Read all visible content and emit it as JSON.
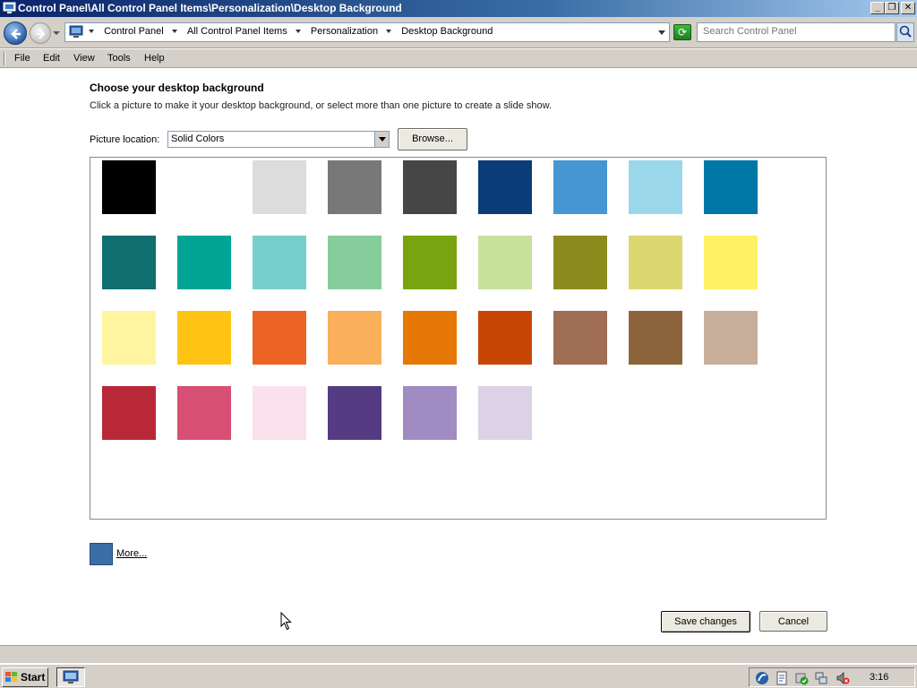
{
  "window": {
    "title": "Control Panel\\All Control Panel Items\\Personalization\\Desktop Background",
    "controls": {
      "minimize": "_",
      "restore": "❐",
      "close": "✕"
    }
  },
  "address": {
    "crumbs": [
      "Control Panel",
      "All Control Panel Items",
      "Personalization",
      "Desktop Background"
    ],
    "search_placeholder": "Search Control Panel"
  },
  "menu": {
    "items": [
      "File",
      "Edit",
      "View",
      "Tools",
      "Help"
    ]
  },
  "page": {
    "heading": "Choose your desktop background",
    "subtext": "Click a picture to make it your desktop background, or select more than one picture to create a slide show.",
    "location_label": "Picture location:",
    "location_value": "Solid Colors",
    "browse_label": "Browse...",
    "more_label": "More...",
    "more_color": "#3a6ea5",
    "save_label": "Save changes",
    "cancel_label": "Cancel"
  },
  "swatches": [
    "#000000",
    "#ffffff",
    "#dcdcdc",
    "#787878",
    "#464646",
    "#0c3c78",
    "#4696d2",
    "#9bd7eb",
    "#0078a5",
    "#0f6e6e",
    "#00a596",
    "#78cdcd",
    "#87cd9b",
    "#78a50f",
    "#c8e19b",
    "#8c8c1e",
    "#dcd76e",
    "#fff064",
    "#fff5a0",
    "#ffc314",
    "#eb6423",
    "#faaf5a",
    "#e67805",
    "#c84605",
    "#a06e55",
    "#8c643c",
    "#c8af9b",
    "#b92837",
    "#d75073",
    "#fae1eb",
    "#553c82",
    "#a08cc3",
    "#dcd2e6"
  ],
  "taskbar": {
    "start_label": "Start",
    "clock": "3:16"
  }
}
